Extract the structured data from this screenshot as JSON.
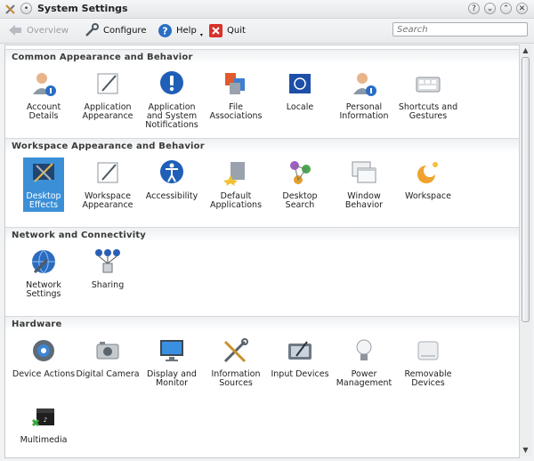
{
  "window": {
    "title": "System Settings",
    "buttons": [
      "?",
      "⌄",
      "⌃",
      "✕"
    ]
  },
  "toolbar": {
    "overview_label": "Overview",
    "configure_label": "Configure",
    "help_label": "Help",
    "quit_label": "Quit",
    "search_placeholder": "Search"
  },
  "sections": [
    {
      "title": "Common Appearance and Behavior",
      "items": [
        {
          "label": "Account Details",
          "icon": "user-info-icon"
        },
        {
          "label": "Application Appearance",
          "icon": "pen-canvas-icon"
        },
        {
          "label": "Application and System Notifications",
          "icon": "exclamation-icon"
        },
        {
          "label": "File Associations",
          "icon": "file-types-icon"
        },
        {
          "label": "Locale",
          "icon": "flag-icon"
        },
        {
          "label": "Personal Information",
          "icon": "user-info-icon"
        },
        {
          "label": "Shortcuts and Gestures",
          "icon": "keyboard-icon"
        }
      ]
    },
    {
      "title": "Workspace Appearance and Behavior",
      "items": [
        {
          "label": "Desktop Effects",
          "icon": "effects-icon",
          "selected": true
        },
        {
          "label": "Workspace Appearance",
          "icon": "pen-canvas-icon"
        },
        {
          "label": "Accessibility",
          "icon": "accessibility-icon"
        },
        {
          "label": "Default Applications",
          "icon": "default-apps-icon"
        },
        {
          "label": "Desktop Search",
          "icon": "search-atoms-icon"
        },
        {
          "label": "Window Behavior",
          "icon": "window-icon"
        },
        {
          "label": "Workspace",
          "icon": "workspace-icon"
        }
      ]
    },
    {
      "title": "Network and Connectivity",
      "items": [
        {
          "label": "Network Settings",
          "icon": "globe-wrench-icon"
        },
        {
          "label": "Sharing",
          "icon": "sharing-icon"
        }
      ]
    },
    {
      "title": "Hardware",
      "items": [
        {
          "label": "Device Actions",
          "icon": "gear-icon"
        },
        {
          "label": "Digital Camera",
          "icon": "camera-icon"
        },
        {
          "label": "Display and Monitor",
          "icon": "monitor-icon"
        },
        {
          "label": "Information Sources",
          "icon": "tools-icon"
        },
        {
          "label": "Input Devices",
          "icon": "tablet-icon"
        },
        {
          "label": "Power Management",
          "icon": "bulb-icon"
        },
        {
          "label": "Removable Devices",
          "icon": "drive-icon"
        },
        {
          "label": "Multimedia",
          "icon": "clapper-icon"
        }
      ]
    }
  ]
}
